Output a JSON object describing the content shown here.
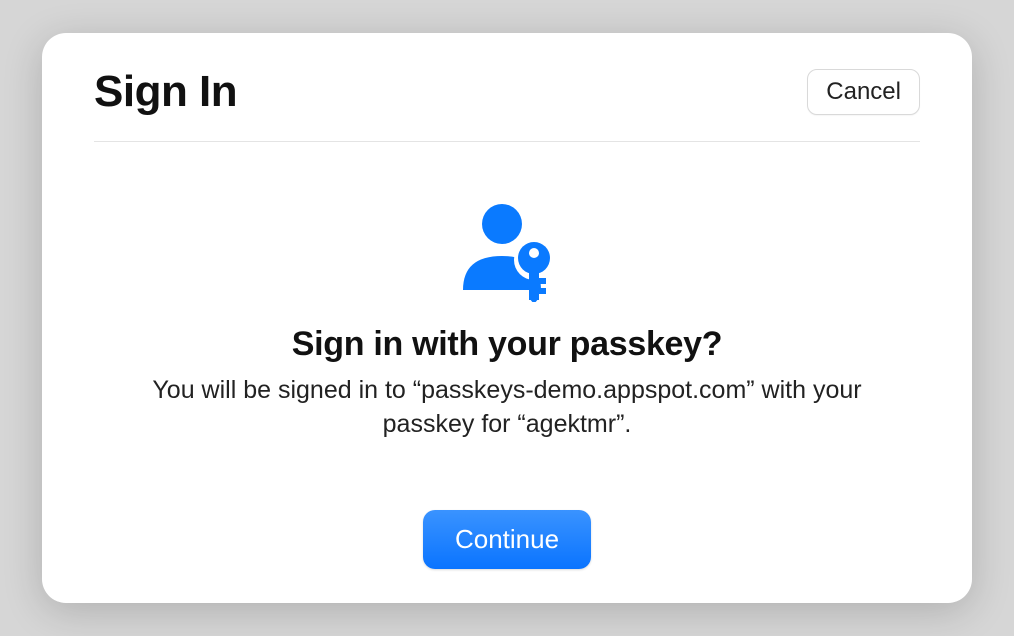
{
  "modal": {
    "title": "Sign In",
    "cancel_label": "Cancel",
    "icon_color": "#0a7aff",
    "prompt_heading": "Sign in with your passkey?",
    "prompt_description": "You will be signed in to “passkeys-demo.appspot.com” with your passkey for “agektmr”.",
    "continue_label": "Continue"
  }
}
